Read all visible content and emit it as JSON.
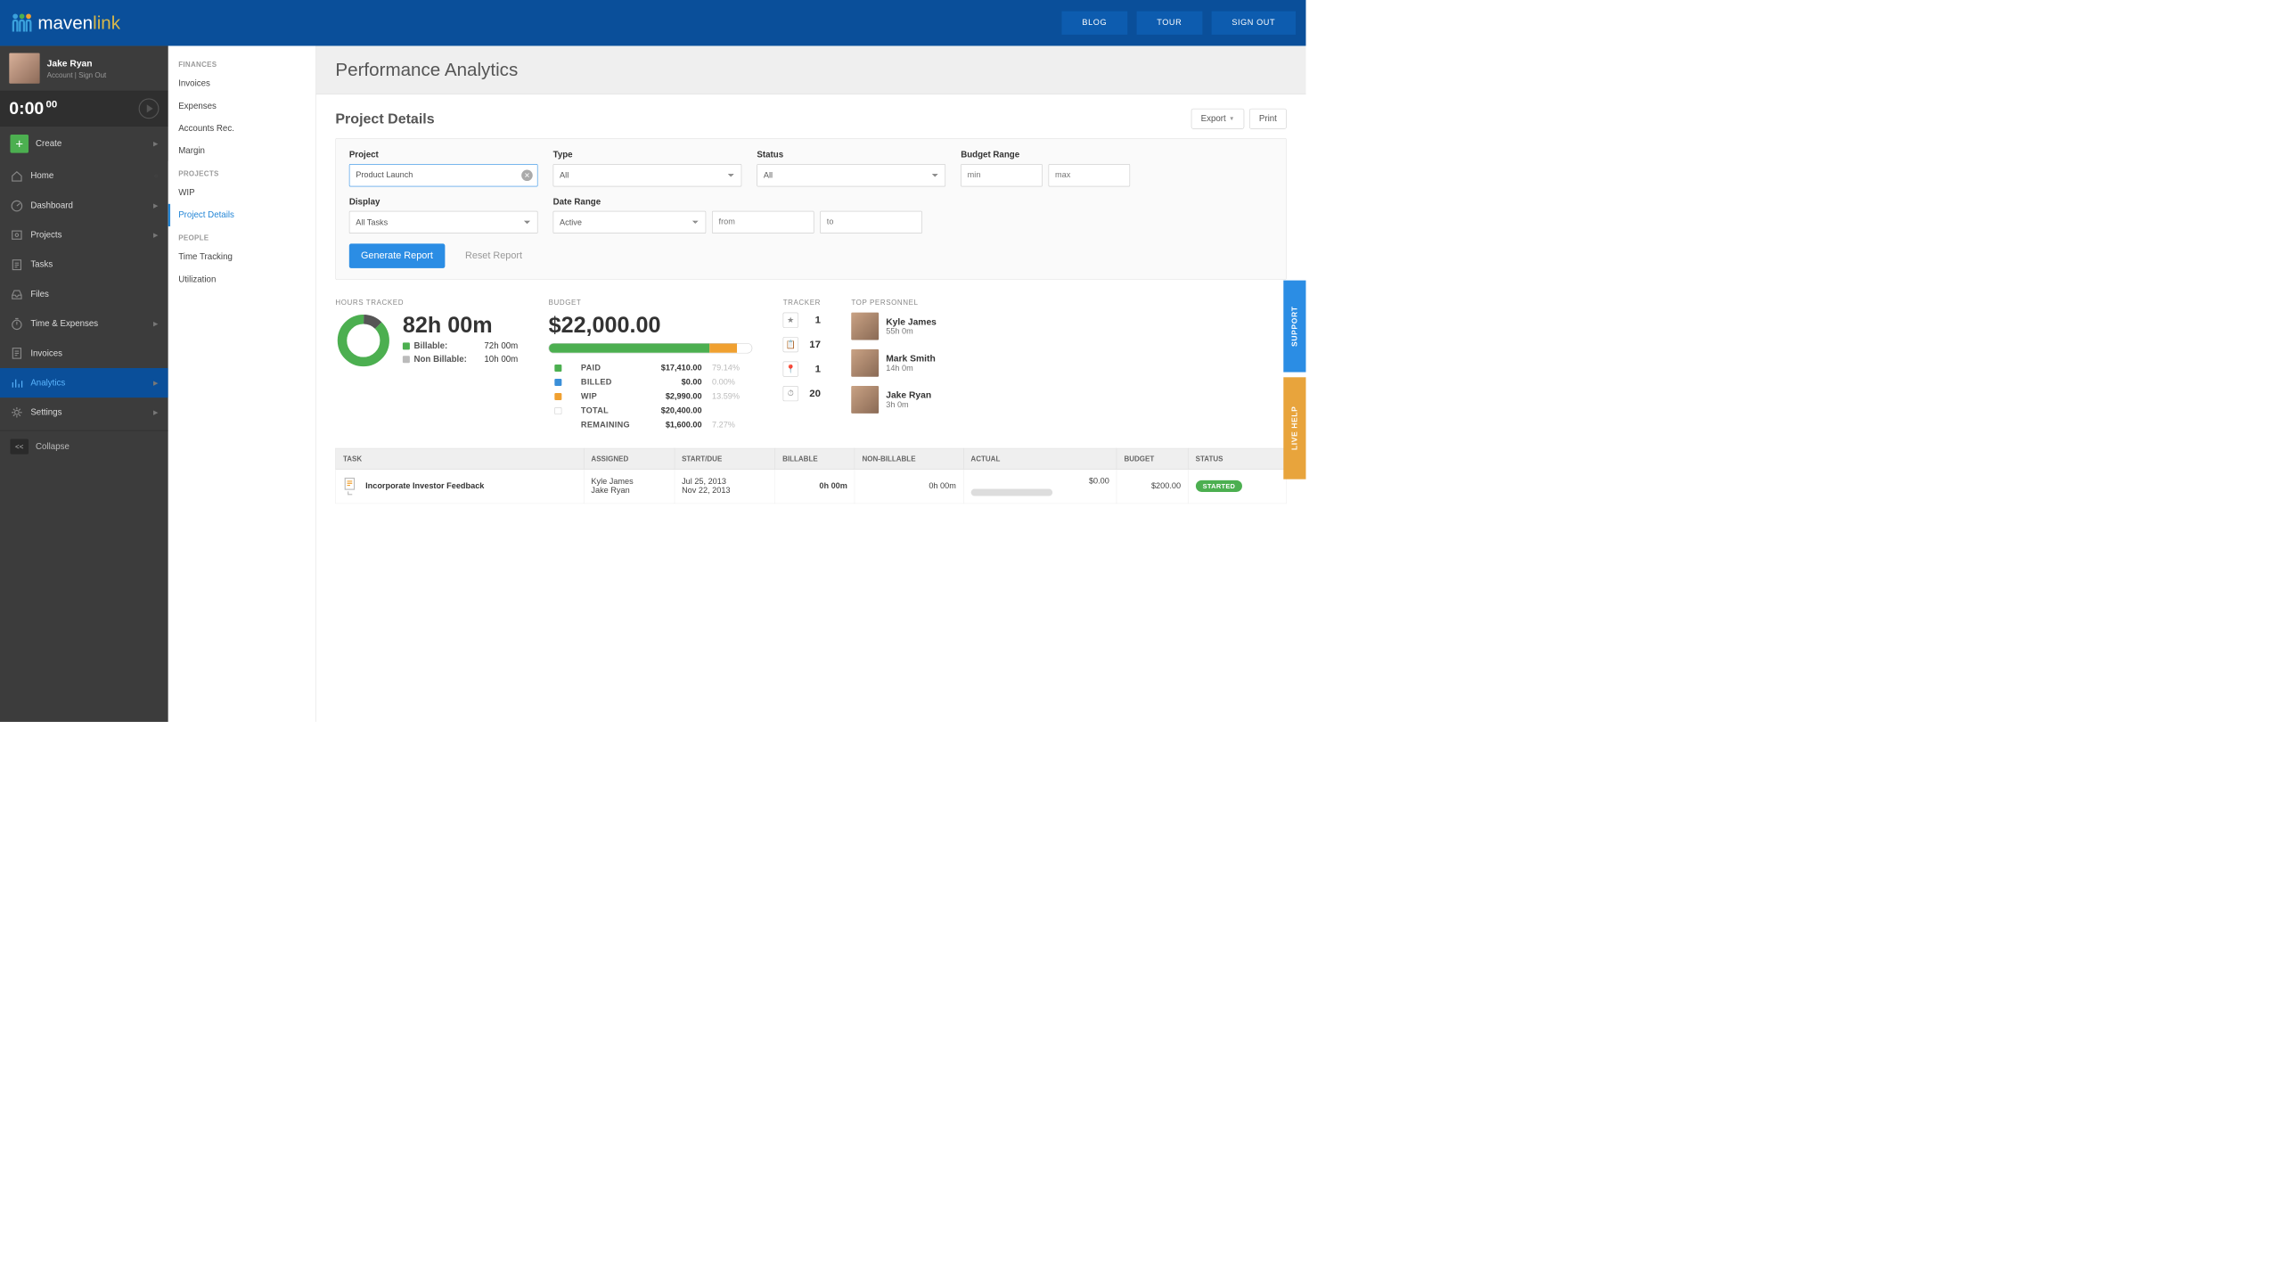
{
  "top": {
    "blog": "BLOG",
    "tour": "TOUR",
    "signout": "SIGN OUT",
    "brand_a": "maven",
    "brand_b": "link"
  },
  "user": {
    "name": "Jake Ryan",
    "sub": "Account | Sign Out",
    "timer": "0:00",
    "timer_sec": "00"
  },
  "nav": {
    "create": "Create",
    "home": "Home",
    "dashboard": "Dashboard",
    "projects": "Projects",
    "tasks": "Tasks",
    "files": "Files",
    "time": "Time & Expenses",
    "invoices": "Invoices",
    "analytics": "Analytics",
    "settings": "Settings",
    "collapse": "Collapse"
  },
  "subnav": {
    "finances": "FINANCES",
    "invoices": "Invoices",
    "expenses": "Expenses",
    "ar": "Accounts Rec.",
    "margin": "Margin",
    "projects": "PROJECTS",
    "wip": "WIP",
    "pd": "Project Details",
    "people": "PEOPLE",
    "tt": "Time Tracking",
    "util": "Utilization"
  },
  "page": {
    "title": "Performance Analytics",
    "section": "Project Details",
    "export": "Export",
    "print": "Print"
  },
  "filters": {
    "project_lbl": "Project",
    "project_val": "Product Launch",
    "type_lbl": "Type",
    "type_val": "All",
    "status_lbl": "Status",
    "status_val": "All",
    "budget_lbl": "Budget Range",
    "min_ph": "min",
    "max_ph": "max",
    "display_lbl": "Display",
    "display_val": "All Tasks",
    "range_lbl": "Date Range",
    "range_val": "Active",
    "from_ph": "from",
    "to_ph": "to",
    "generate": "Generate Report",
    "reset": "Reset Report"
  },
  "hours": {
    "hdr": "HOURS TRACKED",
    "total": "82h 00m",
    "billable_lbl": "Billable:",
    "billable_val": "72h 00m",
    "nonbillable_lbl": "Non Billable:",
    "nonbillable_val": "10h 00m"
  },
  "budget": {
    "hdr": "BUDGET",
    "total": "$22,000.00",
    "rows": [
      {
        "color": "#4caf50",
        "lbl": "PAID",
        "amt": "$17,410.00",
        "pct": "79.14%"
      },
      {
        "color": "#3a8fd8",
        "lbl": "BILLED",
        "amt": "$0.00",
        "pct": "0.00%"
      },
      {
        "color": "#f0a030",
        "lbl": "WIP",
        "amt": "$2,990.00",
        "pct": "13.59%"
      },
      {
        "color": "",
        "lbl": "TOTAL",
        "amt": "$20,400.00",
        "pct": ""
      },
      {
        "color": "#fff",
        "lbl": "REMAINING",
        "amt": "$1,600.00",
        "pct": "7.27%"
      }
    ]
  },
  "tracker": {
    "hdr": "TRACKER",
    "items": [
      {
        "ico": "★",
        "n": "1"
      },
      {
        "ico": "📋",
        "n": "17"
      },
      {
        "ico": "📍",
        "n": "1"
      },
      {
        "ico": "⏱",
        "n": "20"
      }
    ]
  },
  "personnel": {
    "hdr": "TOP PERSONNEL",
    "items": [
      {
        "name": "Kyle James",
        "hrs": "55h 0m"
      },
      {
        "name": "Mark Smith",
        "hrs": "14h 0m"
      },
      {
        "name": "Jake Ryan",
        "hrs": "3h 0m"
      }
    ]
  },
  "table": {
    "cols": [
      "TASK",
      "ASSIGNED",
      "START/DUE",
      "BILLABLE",
      "NON-BILLABLE",
      "ACTUAL",
      "BUDGET",
      "STATUS"
    ],
    "row": {
      "task": "Incorporate Investor Feedback",
      "assigned": "Kyle James\nJake Ryan",
      "dates": "Jul 25, 2013\nNov 22, 2013",
      "billable": "0h 00m",
      "nonbill": "0h 00m",
      "actual": "$0.00",
      "budget": "$200.00",
      "status": "STARTED"
    }
  },
  "sidetabs": {
    "support": "SUPPORT",
    "help": "LIVE HELP"
  },
  "chart_data": {
    "type": "pie",
    "title": "Hours Tracked",
    "categories": [
      "Billable",
      "Non Billable"
    ],
    "values": [
      72,
      10
    ],
    "colors": [
      "#4caf50",
      "#555"
    ]
  }
}
